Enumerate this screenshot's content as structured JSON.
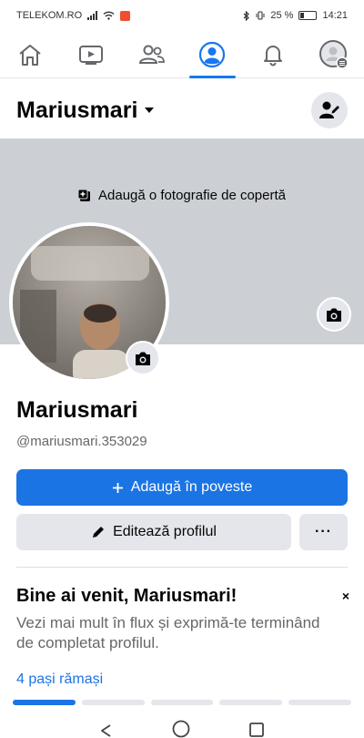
{
  "status_bar": {
    "carrier": "TELEKOM.RO",
    "battery": "25 %",
    "time": "14:21"
  },
  "nav": {
    "items": [
      {
        "name": "home",
        "icon": "home-icon",
        "active": false
      },
      {
        "name": "video",
        "icon": "video-icon",
        "active": false
      },
      {
        "name": "groups",
        "icon": "friends-icon",
        "active": false
      },
      {
        "name": "profile",
        "icon": "profile-icon",
        "active": true
      },
      {
        "name": "notifications",
        "icon": "bell-icon",
        "active": false
      },
      {
        "name": "menu",
        "icon": "avatar-menu-icon",
        "active": false
      }
    ]
  },
  "header": {
    "name": "Mariusmari"
  },
  "cover": {
    "add_cover_label": "Adaugă o fotografie de copertă"
  },
  "profile": {
    "name": "Mariusmari",
    "username": "@mariusmari.353029"
  },
  "actions": {
    "add_story": "Adaugă în poveste",
    "edit_profile": "Editează profilul",
    "more": "···"
  },
  "welcome": {
    "title": "Bine ai venit, Mariusmari!",
    "text": "Vezi mai mult în flux și exprimă-te terminând de completat profilul.",
    "steps_link": "4 pași rămași",
    "steps_total": 5,
    "steps_done": 1,
    "close": "×"
  },
  "colors": {
    "accent": "#1b74e4",
    "cover_bg": "#ccd0d5",
    "button_bg": "#e4e6eb"
  }
}
